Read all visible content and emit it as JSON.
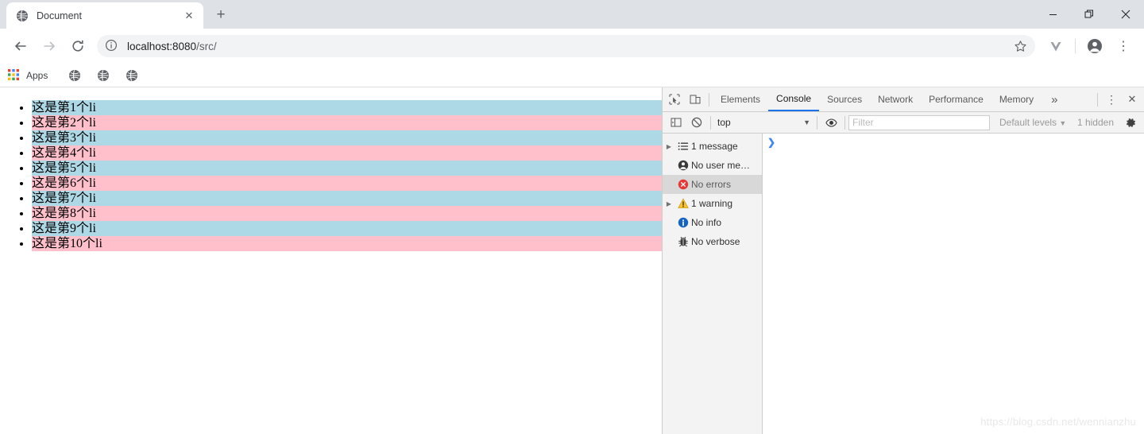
{
  "window": {
    "controls": [
      {
        "name": "minimize",
        "glyph": "—"
      },
      {
        "name": "maximize",
        "glyph": "❐"
      },
      {
        "name": "close",
        "glyph": "✕"
      }
    ]
  },
  "tabs": {
    "active_title": "Document",
    "close_glyph": "✕",
    "new_tab_glyph": "+"
  },
  "toolbar": {
    "back_glyph": "←",
    "forward_glyph": "→",
    "reload_glyph": "⟳",
    "url_host": "localhost:8080",
    "url_path": "/src/",
    "star_glyph": "☆",
    "menu_glyph": "⋮"
  },
  "bookmarks": {
    "apps_label": "Apps",
    "items": [
      "globe-bookmark-1",
      "globe-bookmark-2",
      "globe-bookmark-3"
    ]
  },
  "page": {
    "list_items": [
      "这是第1个li",
      "这是第2个li",
      "这是第3个li",
      "这是第4个li",
      "这是第5个li",
      "这是第6个li",
      "这是第7个li",
      "这是第8个li",
      "这是第9个li",
      "这是第10个li"
    ],
    "odd_row_color": "#add8e6",
    "even_row_color": "#ffc0cb"
  },
  "devtools": {
    "tabs": [
      {
        "label": "Elements",
        "active": false
      },
      {
        "label": "Console",
        "active": true
      },
      {
        "label": "Sources",
        "active": false
      },
      {
        "label": "Network",
        "active": false
      },
      {
        "label": "Performance",
        "active": false
      },
      {
        "label": "Memory",
        "active": false
      }
    ],
    "overflow_glyph": "»",
    "menu_glyph": "⋮",
    "close_glyph": "✕",
    "accent_color": "#1a73e8",
    "filterbar": {
      "context": "top",
      "context_caret": "▼",
      "filter_placeholder": "Filter",
      "levels_label": "Default levels",
      "levels_caret": "▼",
      "hidden_label": "1 hidden"
    },
    "sidebar": [
      {
        "label": "1 message",
        "icon": "list-icon",
        "expandable": true,
        "selected": false
      },
      {
        "label": "No user me…",
        "icon": "user-icon",
        "expandable": false,
        "selected": false
      },
      {
        "label": "No errors",
        "icon": "error-icon",
        "expandable": false,
        "selected": true
      },
      {
        "label": "1 warning",
        "icon": "warning-icon",
        "expandable": true,
        "selected": false
      },
      {
        "label": "No info",
        "icon": "info-icon",
        "expandable": false,
        "selected": false
      },
      {
        "label": "No verbose",
        "icon": "bug-icon",
        "expandable": false,
        "selected": false
      }
    ],
    "console": {
      "prompt_glyph": "❯",
      "prompt_color": "#4285f4"
    }
  },
  "watermark": "https://blog.csdn.net/wennianzhu"
}
